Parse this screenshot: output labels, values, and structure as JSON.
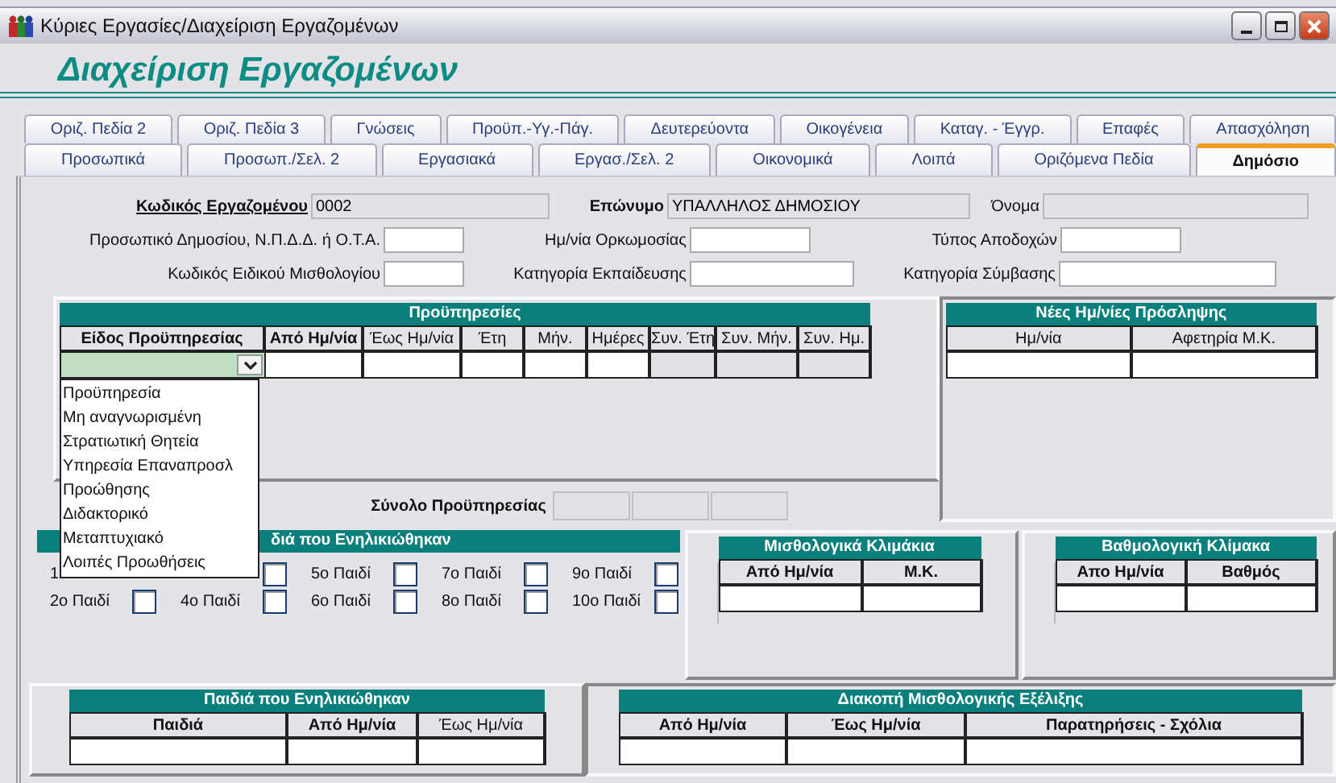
{
  "window": {
    "title": "Κύριες Εργασίες/Διαχείριση Εργαζομένων"
  },
  "heading": "Διαχείριση Εργαζομένων",
  "tab_rows": [
    [
      {
        "label": "Οριζ. Πεδία 2",
        "selected": false
      },
      {
        "label": "Οριζ. Πεδία 3",
        "selected": false
      },
      {
        "label": "Γνώσεις",
        "selected": false
      },
      {
        "label": "Προϋπ.-Υγ.-Πάγ.",
        "selected": false
      },
      {
        "label": "Δευτερεύοντα",
        "selected": false
      },
      {
        "label": "Οικογένεια",
        "selected": false
      },
      {
        "label": "Καταγ. - Έγγρ.",
        "selected": false
      },
      {
        "label": "Επαφές",
        "selected": false
      },
      {
        "label": "Απασχόληση",
        "selected": false
      }
    ],
    [
      {
        "label": "Προσωπικά",
        "selected": false
      },
      {
        "label": "Προσωπ./Σελ. 2",
        "selected": false
      },
      {
        "label": "Εργασιακά",
        "selected": false
      },
      {
        "label": "Εργασ./Σελ. 2",
        "selected": false
      },
      {
        "label": "Οικονομικά",
        "selected": false
      },
      {
        "label": "Λοιπά",
        "selected": false
      },
      {
        "label": "Οριζόμενα Πεδία",
        "selected": false
      },
      {
        "label": "Δημόσιο",
        "selected": true
      }
    ]
  ],
  "form_rows": [
    [
      {
        "label": "Κωδικός Εργαζομένου",
        "kind": "key",
        "value": "0002",
        "readonly": true
      },
      {
        "label": "Επώνυμο",
        "kind": "bold",
        "value": "ΥΠΑΛΛΗΛΟΣ ΔΗΜΟΣΙΟΥ",
        "readonly": true
      },
      {
        "label": "Όνομα",
        "kind": "plain",
        "readonly": true
      }
    ],
    [
      {
        "label": "Προσωπικό Δημοσίου, Ν.Π.Δ.Δ. ή Ο.Τ.Α.",
        "kind": "plain",
        "readonly": false
      },
      {
        "label": "Ημ/νία Ορκωμοσίας",
        "kind": "plain",
        "readonly": false
      },
      {
        "label": "Τύπος Αποδοχών",
        "kind": "plain",
        "readonly": false
      }
    ],
    [
      {
        "label": "Κωδικός Ειδικού Μισθολογίου",
        "kind": "plain",
        "readonly": false
      },
      {
        "label": "Κατηγορία Εκπαίδευσης",
        "kind": "plain",
        "readonly": false
      },
      {
        "label": "Κατηγορία Σύμβασης",
        "kind": "plain",
        "readonly": false
      }
    ]
  ],
  "service_table": {
    "title": "Προϋπηρεσίες",
    "columns": [
      {
        "label": "Είδος Προϋπηρεσίας",
        "kind": "bold"
      },
      {
        "label": "Από Ημ/νία",
        "kind": "bold"
      },
      {
        "label": "Έως Ημ/νία",
        "kind": "plain"
      },
      {
        "label": "Έτη",
        "kind": "plain"
      },
      {
        "label": "Μήν.",
        "kind": "plain"
      },
      {
        "label": "Ημέρες",
        "kind": "plain"
      },
      {
        "label": "Συν. Έτη",
        "kind": "plain"
      },
      {
        "label": "Συν. Μήν.",
        "kind": "plain"
      },
      {
        "label": "Συν. Ημ.",
        "kind": "plain"
      }
    ],
    "row": [
      {
        "kind": "combo",
        "expanded": true,
        "options": [
          "Προϋπηρεσία",
          "Μη αναγνωρισμένη",
          "Στρατιωτική Θητεία",
          "Υπηρεσία  Επαναπροσλ",
          "Προώθησης",
          "Διδακτορικό",
          "Μεταπτυχιακό",
          "Λοιπές Προωθήσεις"
        ]
      },
      {
        "kind": "input"
      },
      {
        "kind": "input"
      },
      {
        "kind": "input"
      },
      {
        "kind": "input"
      },
      {
        "kind": "input"
      },
      {
        "kind": "readonly"
      },
      {
        "kind": "readonly"
      },
      {
        "kind": "readonly"
      }
    ],
    "total_label": "Σύνολο Προϋπηρεσίας"
  },
  "hire_dates_table": {
    "title": "Νέες Ημ/νίες Πρόσληψης",
    "columns": [
      {
        "label": "Ημ/νία",
        "kind": "plain"
      },
      {
        "label": "Αφετηρία Μ.Κ.",
        "kind": "plain"
      }
    ],
    "row": [
      {
        "kind": "input"
      },
      {
        "kind": "input"
      }
    ]
  },
  "adult_children_section": {
    "title": "διά που Ενηλικιώθηκαν",
    "checkboxes": [
      {
        "label": "1"
      },
      {
        "label": "2ο Παιδί",
        "checked": false
      },
      {
        "checked": false
      },
      {
        "label": "4ο Παιδί",
        "checked": false
      },
      {
        "label": "5ο Παιδί",
        "checked": false
      },
      {
        "label": "6ο Παιδί",
        "checked": false
      },
      {
        "label": "7ο Παιδί",
        "checked": false
      },
      {
        "label": "8ο Παιδί",
        "checked": false
      },
      {
        "label": "9ο Παιδί",
        "checked": false
      },
      {
        "label": "10ο Παιδί",
        "checked": false
      }
    ]
  },
  "salary_steps_table": {
    "title": "Μισθολογικά Κλιμάκια",
    "columns": [
      {
        "label": "Από Ημ/νία",
        "kind": "bold"
      },
      {
        "label": "Μ.Κ.",
        "kind": "bold"
      }
    ],
    "row": [
      {
        "kind": "input"
      },
      {
        "kind": "input"
      }
    ]
  },
  "grade_scale_table": {
    "title": "Βαθμολογική Κλίμακα",
    "columns": [
      {
        "label": "Απο Ημ/νία",
        "kind": "bold"
      },
      {
        "label": "Βαθμός",
        "kind": "bold"
      }
    ],
    "row": [
      {
        "kind": "input"
      },
      {
        "kind": "input"
      }
    ]
  },
  "adult_children_table": {
    "title": "Παιδιά που Ενηλικιώθηκαν",
    "columns": [
      {
        "label": "Παιδιά",
        "kind": "bold"
      },
      {
        "label": "Από Ημ/νία",
        "kind": "bold"
      },
      {
        "label": "Έως Ημ/νία",
        "kind": "plain"
      }
    ],
    "row": [
      {
        "kind": "input"
      },
      {
        "kind": "input"
      },
      {
        "kind": "input"
      }
    ]
  },
  "salary_interruption_table": {
    "title": "Διακοπή Μισθολογικής Εξέλιξης",
    "columns": [
      {
        "label": "Από Ημ/νία",
        "kind": "bold"
      },
      {
        "label": "Έως Ημ/νία",
        "kind": "bold"
      },
      {
        "label": "Παρατηρήσεις - Σχόλια",
        "kind": "bold"
      }
    ],
    "row": [
      {
        "kind": "input"
      },
      {
        "kind": "input"
      },
      {
        "kind": "input"
      }
    ]
  }
}
